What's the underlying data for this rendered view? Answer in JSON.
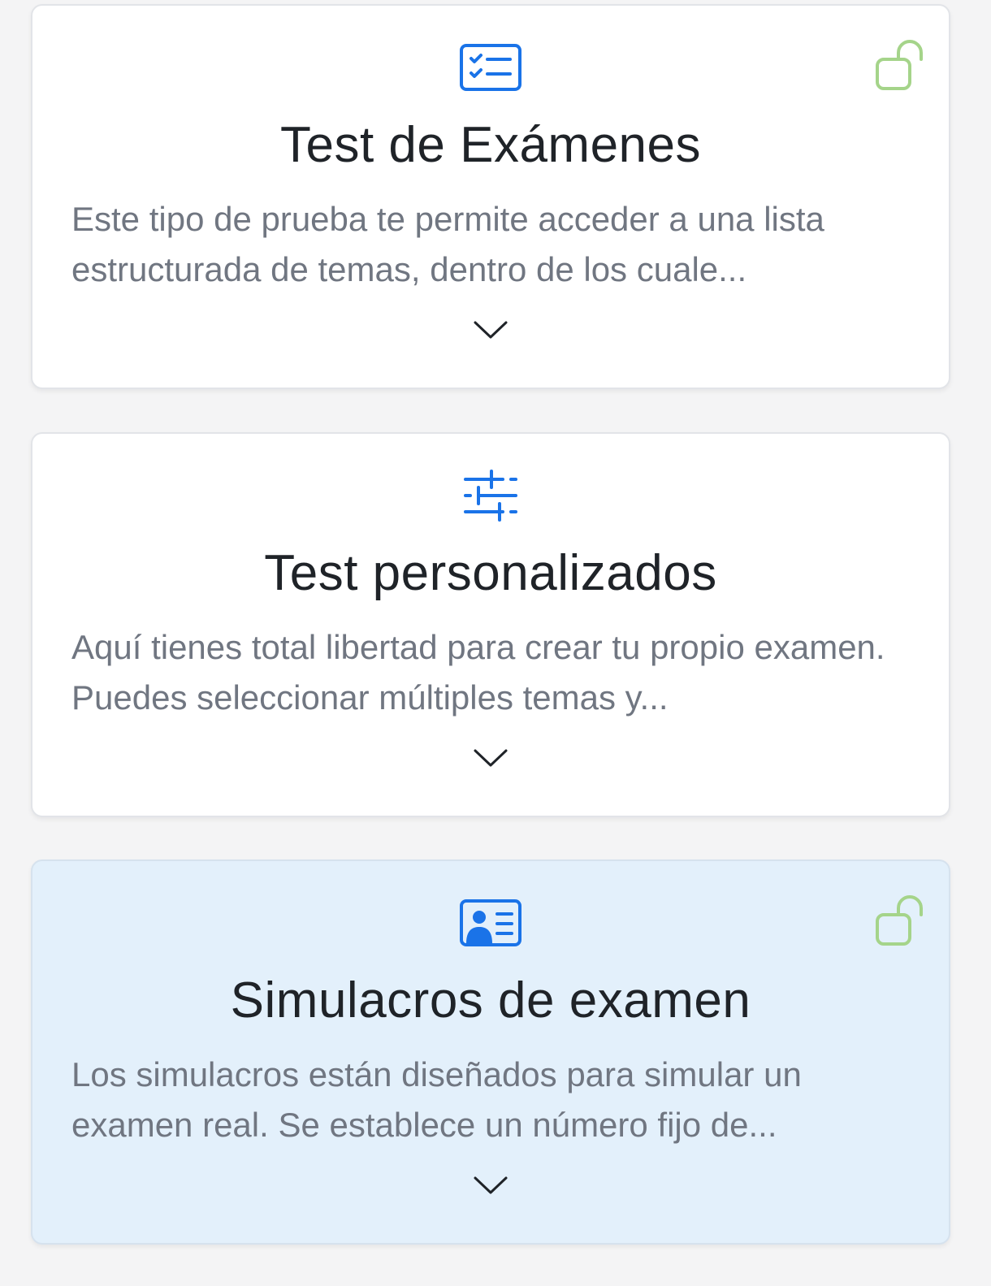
{
  "colors": {
    "icon_blue": "#1a73e8",
    "lock_green": "#a5d48a",
    "title": "#1f2328",
    "description": "#707681",
    "selected_background": "#e3f0fb"
  },
  "cards": [
    {
      "title": "Test de Exámenes",
      "description": "Este tipo de prueba te permite acceder a una lista estructurada de temas, dentro de los cuale...",
      "icon": "checklist-icon",
      "lock": "unlocked-lock-icon",
      "selected": false
    },
    {
      "title": "Test personalizados",
      "description": "Aquí tienes total libertad para crear tu propio examen. Puedes seleccionar múltiples temas y...",
      "icon": "sliders-icon",
      "lock": null,
      "selected": false
    },
    {
      "title": "Simulacros de examen",
      "description": "Los simulacros están diseñados para simular un examen real. Se establece un número fijo de...",
      "icon": "id-card-icon",
      "lock": "unlocked-lock-icon",
      "selected": true
    }
  ]
}
